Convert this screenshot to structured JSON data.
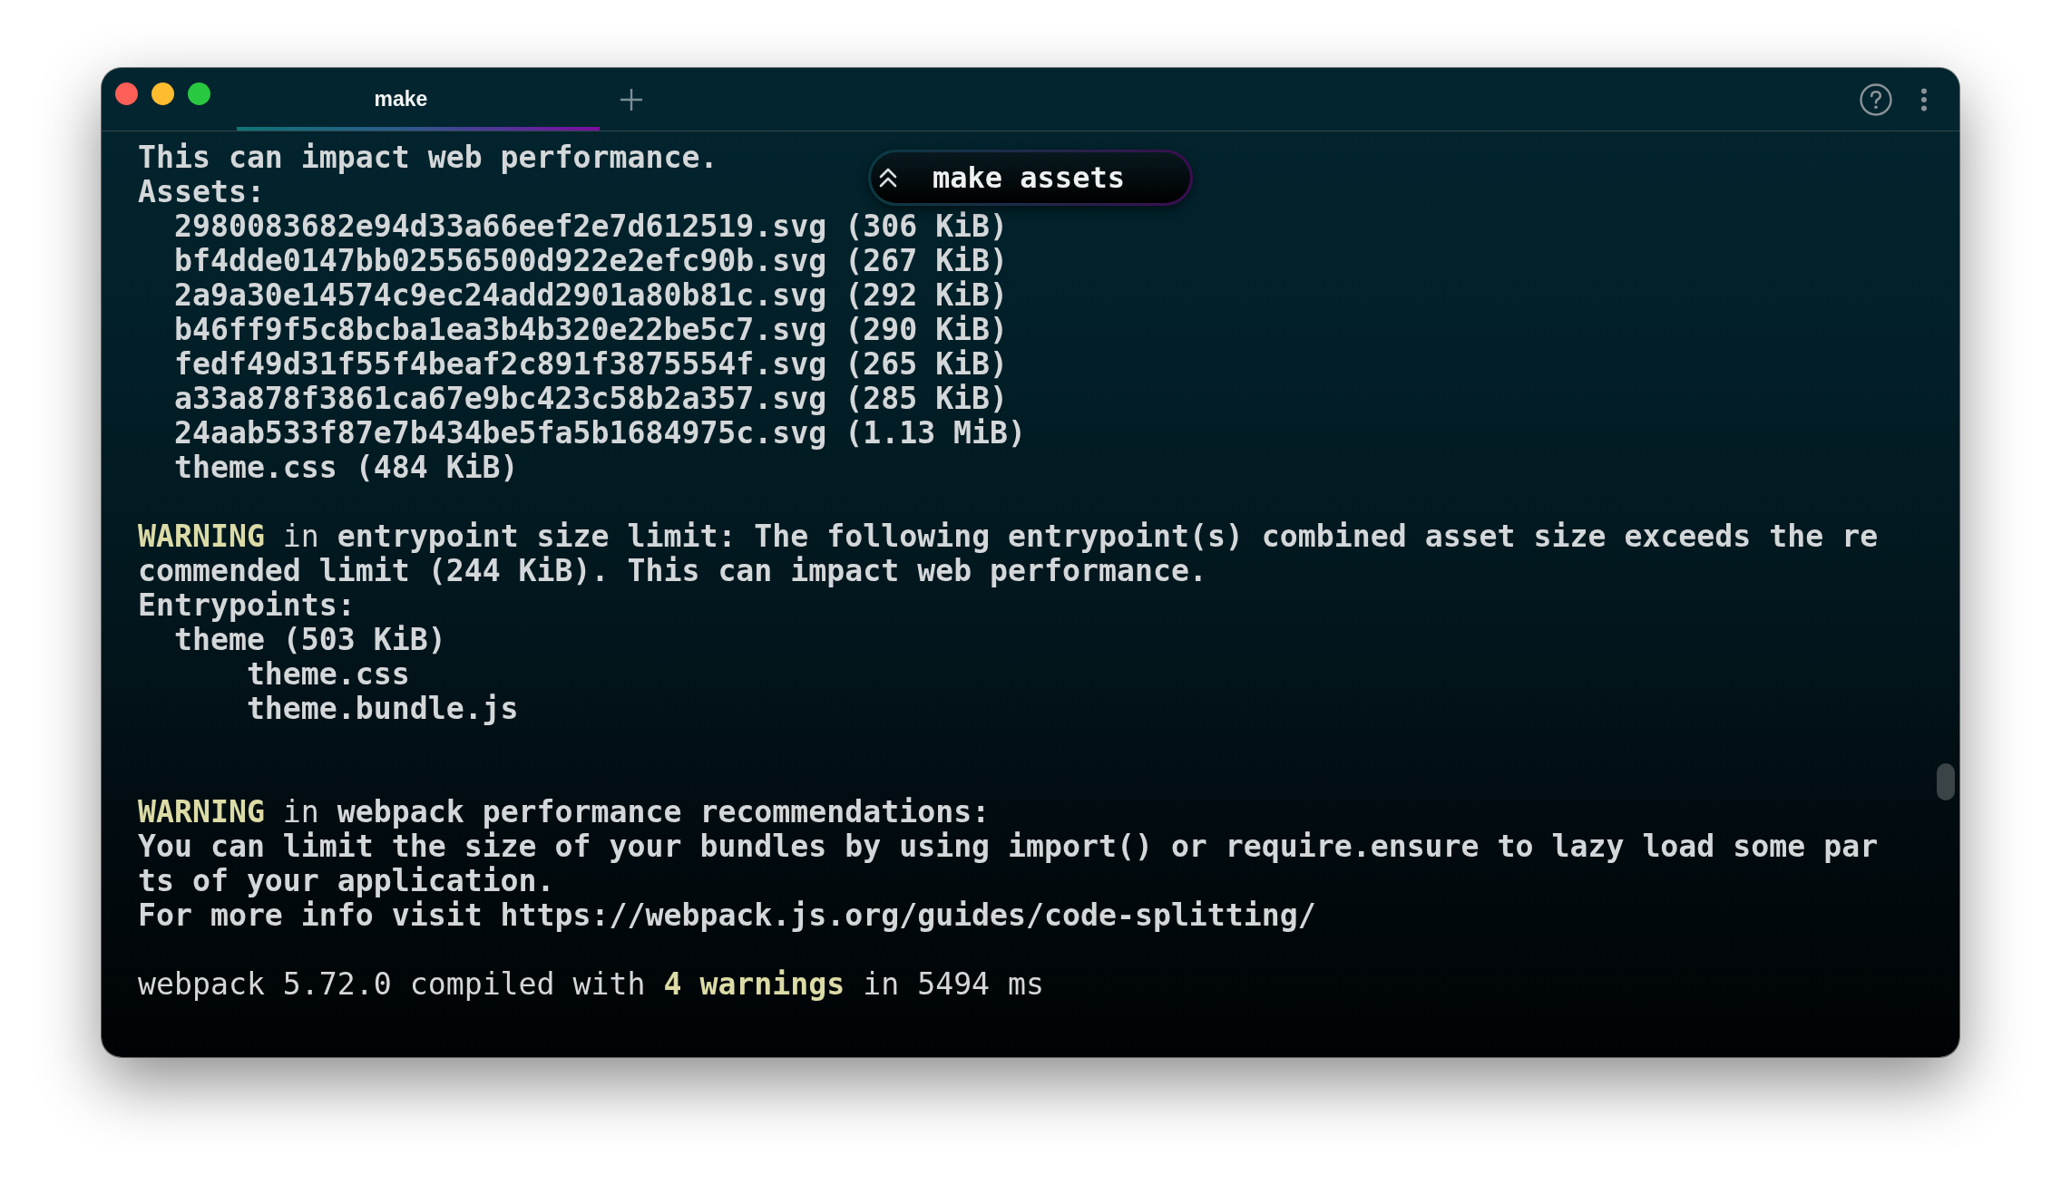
{
  "title_bar": {
    "tabs": [
      {
        "label": "make",
        "selected": true
      }
    ]
  },
  "command_pill": {
    "label": "make assets"
  },
  "terminal": {
    "lines": [
      {
        "kind": "text",
        "segments": [
          {
            "kind": "bold",
            "text": "This can impact web performance."
          }
        ]
      },
      {
        "kind": "text",
        "segments": [
          {
            "kind": "bold",
            "text": "Assets:"
          }
        ],
        "children": [
          {
            "kind": "text",
            "segments": [
              {
                "kind": "bold",
                "text": "2980083682e94d33a66eef2e7d612519.svg (306 KiB)"
              }
            ]
          },
          {
            "kind": "text",
            "segments": [
              {
                "kind": "bold",
                "text": "bf4dde0147bb02556500d922e2efc90b.svg (267 KiB)"
              }
            ]
          },
          {
            "kind": "text",
            "segments": [
              {
                "kind": "bold",
                "text": "2a9a30e14574c9ec24add2901a80b81c.svg (292 KiB)"
              }
            ]
          },
          {
            "kind": "text",
            "segments": [
              {
                "kind": "bold",
                "text": "b46ff9f5c8bcba1ea3b4b320e22be5c7.svg (290 KiB)"
              }
            ]
          },
          {
            "kind": "text",
            "segments": [
              {
                "kind": "bold",
                "text": "fedf49d31f55f4beaf2c891f3875554f.svg (265 KiB)"
              }
            ]
          },
          {
            "kind": "text",
            "segments": [
              {
                "kind": "bold",
                "text": "a33a878f3861ca67e9bc423c58b2a357.svg (285 KiB)"
              }
            ]
          },
          {
            "kind": "text",
            "segments": [
              {
                "kind": "bold",
                "text": "24aab533f87e7b434be5fa5b1684975c.svg (1.13 MiB)"
              }
            ]
          },
          {
            "kind": "text",
            "segments": [
              {
                "kind": "bold",
                "text": "theme.css (484 KiB)"
              }
            ]
          }
        ]
      },
      {
        "kind": "blank"
      },
      {
        "kind": "text",
        "segments": [
          {
            "kind": "warning",
            "text": "WARNING"
          },
          {
            "kind": "plain",
            "text": " in "
          },
          {
            "kind": "bold",
            "text": "entrypoint size limit: The following entrypoint(s) combined asset size exceeds the re"
          }
        ]
      },
      {
        "kind": "text",
        "segments": [
          {
            "kind": "bold",
            "text": "commended limit (244 KiB). This can impact web performance."
          }
        ]
      },
      {
        "kind": "text",
        "segments": [
          {
            "kind": "bold",
            "text": "Entrypoints:"
          }
        ],
        "children": [
          {
            "kind": "text",
            "segments": [
              {
                "kind": "bold",
                "text": "theme (503 KiB)"
              }
            ],
            "children": [
              {
                "kind": "text",
                "segments": [
                  {
                    "kind": "bold",
                    "text": "theme.css"
                  }
                ]
              },
              {
                "kind": "text",
                "segments": [
                  {
                    "kind": "bold",
                    "text": "theme.bundle.js"
                  }
                ]
              }
            ]
          }
        ]
      },
      {
        "kind": "blank"
      },
      {
        "kind": "blank"
      },
      {
        "kind": "text",
        "segments": [
          {
            "kind": "warning",
            "text": "WARNING"
          },
          {
            "kind": "plain",
            "text": " in "
          },
          {
            "kind": "bold",
            "text": "webpack performance recommendations:"
          }
        ]
      },
      {
        "kind": "text",
        "segments": [
          {
            "kind": "bold",
            "text": "You can limit the size of your bundles by using import() or require.ensure to lazy load some par"
          }
        ]
      },
      {
        "kind": "text",
        "segments": [
          {
            "kind": "bold",
            "text": "ts of your application."
          }
        ]
      },
      {
        "kind": "text",
        "segments": [
          {
            "kind": "bold",
            "text": "For more info visit https://webpack.js.org/guides/code-splitting/"
          }
        ]
      },
      {
        "kind": "blank"
      },
      {
        "kind": "text",
        "segments": [
          {
            "kind": "plain",
            "text": "webpack 5.72.0 compiled with "
          },
          {
            "kind": "warning",
            "text": "4 warnings"
          },
          {
            "kind": "plain",
            "text": " in 5494 ms"
          }
        ]
      }
    ]
  }
}
